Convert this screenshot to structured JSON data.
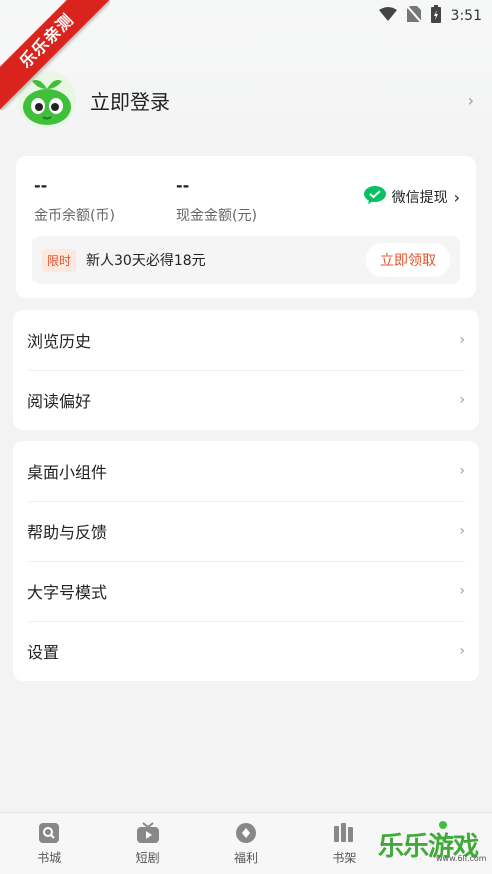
{
  "status_bar": {
    "time": "3:51"
  },
  "ribbon": {
    "text": "乐乐亲测"
  },
  "profile": {
    "login_label": "立即登录"
  },
  "wallet": {
    "coin_value": "--",
    "coin_label": "金币余额(币)",
    "cash_value": "--",
    "cash_label": "现金金额(元)",
    "wechat_label": "微信提现",
    "promo_tag": "限时",
    "promo_text": "新人30天必得18元",
    "promo_button": "立即领取"
  },
  "menu_group_1": [
    {
      "label": "浏览历史"
    },
    {
      "label": "阅读偏好"
    }
  ],
  "menu_group_2": [
    {
      "label": "桌面小组件"
    },
    {
      "label": "帮助与反馈"
    },
    {
      "label": "大字号模式"
    },
    {
      "label": "设置"
    }
  ],
  "bottom_nav": [
    {
      "label": "书城",
      "icon": "search-book-icon"
    },
    {
      "label": "短剧",
      "icon": "tv-icon"
    },
    {
      "label": "福利",
      "icon": "gift-icon"
    },
    {
      "label": "书架",
      "icon": "bookshelf-icon"
    }
  ],
  "watermark": {
    "text": "乐乐游戏",
    "url": "www.6ll.com"
  },
  "colors": {
    "accent": "#e0552f",
    "wechat_green": "#07c160",
    "ribbon_red": "#d9231c"
  }
}
